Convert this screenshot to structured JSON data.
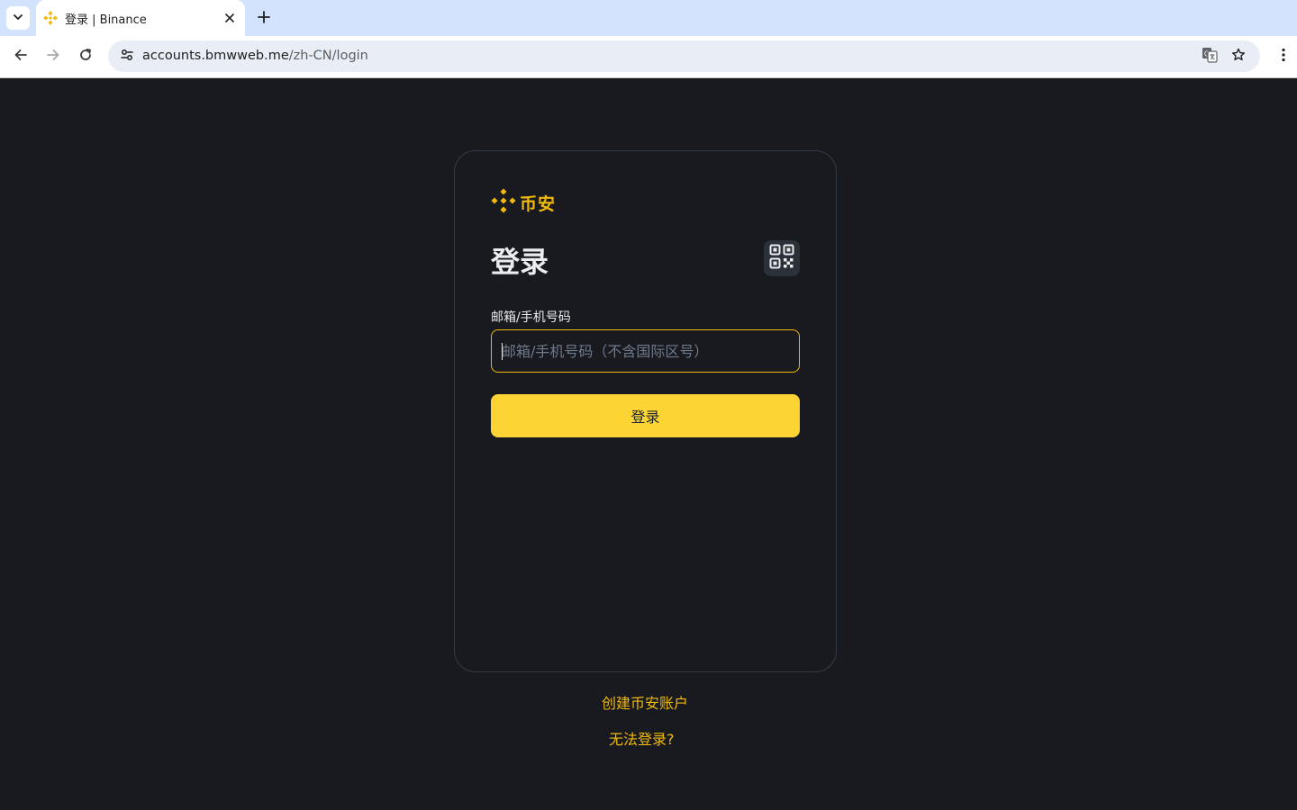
{
  "browser": {
    "tab_title": "登录 | Binance",
    "url_host": "accounts.bmwweb.me",
    "url_path": "/zh-CN/login",
    "icons": [
      "tab-list-icon",
      "binance-favicon-icon",
      "close-icon",
      "plus-icon",
      "back-arrow-icon",
      "forward-arrow-icon",
      "reload-icon",
      "site-info-icon",
      "translate-icon",
      "star-icon",
      "more-vert-icon"
    ]
  },
  "login": {
    "brand_name": "币安",
    "title": "登录",
    "field_label": "邮箱/手机号码",
    "input_placeholder": "邮箱/手机号码（不含国际区号）",
    "input_value": "",
    "submit_label": "登录"
  },
  "links": {
    "create_account": "创建币安账户",
    "cant_login": "无法登录?"
  },
  "colors": {
    "background": "#181a20",
    "brand_yellow": "#f0b90b",
    "button_yellow": "#fcd535",
    "text_primary": "#eaecef",
    "text_placeholder": "#707a8a",
    "card_border": "#333b47"
  }
}
